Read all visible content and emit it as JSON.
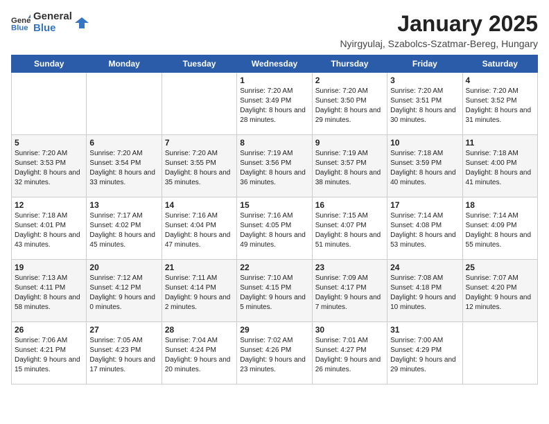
{
  "logo": {
    "general": "General",
    "blue": "Blue"
  },
  "title": "January 2025",
  "subtitle": "Nyirgyulaj, Szabolcs-Szatmar-Bereg, Hungary",
  "weekdays": [
    "Sunday",
    "Monday",
    "Tuesday",
    "Wednesday",
    "Thursday",
    "Friday",
    "Saturday"
  ],
  "weeks": [
    [
      {
        "day": "",
        "sunrise": "",
        "sunset": "",
        "daylight": ""
      },
      {
        "day": "",
        "sunrise": "",
        "sunset": "",
        "daylight": ""
      },
      {
        "day": "",
        "sunrise": "",
        "sunset": "",
        "daylight": ""
      },
      {
        "day": "1",
        "sunrise": "Sunrise: 7:20 AM",
        "sunset": "Sunset: 3:49 PM",
        "daylight": "Daylight: 8 hours and 28 minutes."
      },
      {
        "day": "2",
        "sunrise": "Sunrise: 7:20 AM",
        "sunset": "Sunset: 3:50 PM",
        "daylight": "Daylight: 8 hours and 29 minutes."
      },
      {
        "day": "3",
        "sunrise": "Sunrise: 7:20 AM",
        "sunset": "Sunset: 3:51 PM",
        "daylight": "Daylight: 8 hours and 30 minutes."
      },
      {
        "day": "4",
        "sunrise": "Sunrise: 7:20 AM",
        "sunset": "Sunset: 3:52 PM",
        "daylight": "Daylight: 8 hours and 31 minutes."
      }
    ],
    [
      {
        "day": "5",
        "sunrise": "Sunrise: 7:20 AM",
        "sunset": "Sunset: 3:53 PM",
        "daylight": "Daylight: 8 hours and 32 minutes."
      },
      {
        "day": "6",
        "sunrise": "Sunrise: 7:20 AM",
        "sunset": "Sunset: 3:54 PM",
        "daylight": "Daylight: 8 hours and 33 minutes."
      },
      {
        "day": "7",
        "sunrise": "Sunrise: 7:20 AM",
        "sunset": "Sunset: 3:55 PM",
        "daylight": "Daylight: 8 hours and 35 minutes."
      },
      {
        "day": "8",
        "sunrise": "Sunrise: 7:19 AM",
        "sunset": "Sunset: 3:56 PM",
        "daylight": "Daylight: 8 hours and 36 minutes."
      },
      {
        "day": "9",
        "sunrise": "Sunrise: 7:19 AM",
        "sunset": "Sunset: 3:57 PM",
        "daylight": "Daylight: 8 hours and 38 minutes."
      },
      {
        "day": "10",
        "sunrise": "Sunrise: 7:18 AM",
        "sunset": "Sunset: 3:59 PM",
        "daylight": "Daylight: 8 hours and 40 minutes."
      },
      {
        "day": "11",
        "sunrise": "Sunrise: 7:18 AM",
        "sunset": "Sunset: 4:00 PM",
        "daylight": "Daylight: 8 hours and 41 minutes."
      }
    ],
    [
      {
        "day": "12",
        "sunrise": "Sunrise: 7:18 AM",
        "sunset": "Sunset: 4:01 PM",
        "daylight": "Daylight: 8 hours and 43 minutes."
      },
      {
        "day": "13",
        "sunrise": "Sunrise: 7:17 AM",
        "sunset": "Sunset: 4:02 PM",
        "daylight": "Daylight: 8 hours and 45 minutes."
      },
      {
        "day": "14",
        "sunrise": "Sunrise: 7:16 AM",
        "sunset": "Sunset: 4:04 PM",
        "daylight": "Daylight: 8 hours and 47 minutes."
      },
      {
        "day": "15",
        "sunrise": "Sunrise: 7:16 AM",
        "sunset": "Sunset: 4:05 PM",
        "daylight": "Daylight: 8 hours and 49 minutes."
      },
      {
        "day": "16",
        "sunrise": "Sunrise: 7:15 AM",
        "sunset": "Sunset: 4:07 PM",
        "daylight": "Daylight: 8 hours and 51 minutes."
      },
      {
        "day": "17",
        "sunrise": "Sunrise: 7:14 AM",
        "sunset": "Sunset: 4:08 PM",
        "daylight": "Daylight: 8 hours and 53 minutes."
      },
      {
        "day": "18",
        "sunrise": "Sunrise: 7:14 AM",
        "sunset": "Sunset: 4:09 PM",
        "daylight": "Daylight: 8 hours and 55 minutes."
      }
    ],
    [
      {
        "day": "19",
        "sunrise": "Sunrise: 7:13 AM",
        "sunset": "Sunset: 4:11 PM",
        "daylight": "Daylight: 8 hours and 58 minutes."
      },
      {
        "day": "20",
        "sunrise": "Sunrise: 7:12 AM",
        "sunset": "Sunset: 4:12 PM",
        "daylight": "Daylight: 9 hours and 0 minutes."
      },
      {
        "day": "21",
        "sunrise": "Sunrise: 7:11 AM",
        "sunset": "Sunset: 4:14 PM",
        "daylight": "Daylight: 9 hours and 2 minutes."
      },
      {
        "day": "22",
        "sunrise": "Sunrise: 7:10 AM",
        "sunset": "Sunset: 4:15 PM",
        "daylight": "Daylight: 9 hours and 5 minutes."
      },
      {
        "day": "23",
        "sunrise": "Sunrise: 7:09 AM",
        "sunset": "Sunset: 4:17 PM",
        "daylight": "Daylight: 9 hours and 7 minutes."
      },
      {
        "day": "24",
        "sunrise": "Sunrise: 7:08 AM",
        "sunset": "Sunset: 4:18 PM",
        "daylight": "Daylight: 9 hours and 10 minutes."
      },
      {
        "day": "25",
        "sunrise": "Sunrise: 7:07 AM",
        "sunset": "Sunset: 4:20 PM",
        "daylight": "Daylight: 9 hours and 12 minutes."
      }
    ],
    [
      {
        "day": "26",
        "sunrise": "Sunrise: 7:06 AM",
        "sunset": "Sunset: 4:21 PM",
        "daylight": "Daylight: 9 hours and 15 minutes."
      },
      {
        "day": "27",
        "sunrise": "Sunrise: 7:05 AM",
        "sunset": "Sunset: 4:23 PM",
        "daylight": "Daylight: 9 hours and 17 minutes."
      },
      {
        "day": "28",
        "sunrise": "Sunrise: 7:04 AM",
        "sunset": "Sunset: 4:24 PM",
        "daylight": "Daylight: 9 hours and 20 minutes."
      },
      {
        "day": "29",
        "sunrise": "Sunrise: 7:02 AM",
        "sunset": "Sunset: 4:26 PM",
        "daylight": "Daylight: 9 hours and 23 minutes."
      },
      {
        "day": "30",
        "sunrise": "Sunrise: 7:01 AM",
        "sunset": "Sunset: 4:27 PM",
        "daylight": "Daylight: 9 hours and 26 minutes."
      },
      {
        "day": "31",
        "sunrise": "Sunrise: 7:00 AM",
        "sunset": "Sunset: 4:29 PM",
        "daylight": "Daylight: 9 hours and 29 minutes."
      },
      {
        "day": "",
        "sunrise": "",
        "sunset": "",
        "daylight": ""
      }
    ]
  ]
}
